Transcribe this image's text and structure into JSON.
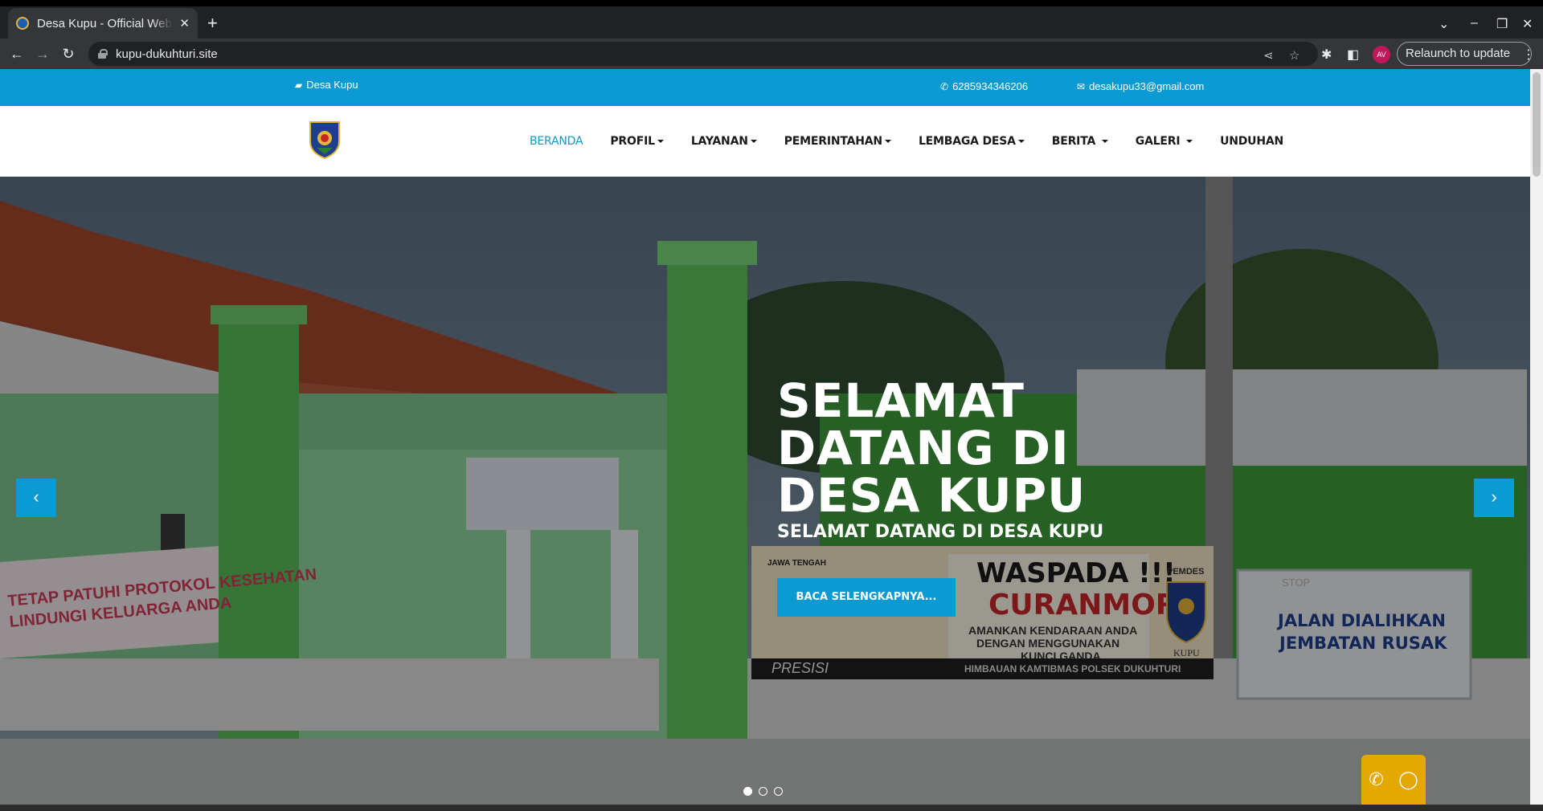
{
  "browser": {
    "tab_title": "Desa Kupu - Official Website",
    "url": "kupu-dukuhturi.site",
    "avatar_initials": "AV",
    "relaunch_label": "Relaunch to update"
  },
  "topbar": {
    "site_name": "Desa Kupu",
    "phone": "6285934346206",
    "email": "desakupu33@gmail.com"
  },
  "nav": {
    "items": [
      {
        "label": "BERANDA"
      },
      {
        "label": "PROFIL"
      },
      {
        "label": "LAYANAN"
      },
      {
        "label": "PEMERINTAHAN"
      },
      {
        "label": "LEMBAGA DESA"
      },
      {
        "label": "BERITA"
      },
      {
        "label": "GALERI"
      },
      {
        "label": "UNDUHAN"
      }
    ]
  },
  "hero": {
    "title": "SELAMAT DATANG DI DESA KUPU",
    "subtitle": "SELAMAT DATANG DI DESA KUPU",
    "button_label": "BACA SELENGKAPNYA...",
    "banner_left": "TETAP PATUHI PROTOKOL KESEHATAN LINDUNGI KELUARGA ANDA",
    "banner_waspada": "WASPADA !!!",
    "banner_curanmor": "CURANMOR",
    "banner_curanmor_sub": "AMANKAN KENDARAAN ANDA DENGAN MENGGUNAKAN KUNCI GANDA",
    "banner_bottom": "HIMBAUAN KAMTIBMAS POLSEK DUKUHTURI",
    "banner_right": "JALAN DIALIHKAN JEMBATAN RUSAK",
    "banner_jateng": "JAWA TENGAH",
    "banner_presisi": "PRESISI",
    "banner_pemdes": "PEMDES",
    "banner_kupu": "KUPU",
    "banner_stop": "STOP",
    "slides": 3,
    "active_slide": 1
  },
  "colors": {
    "accent": "#0b9ad1",
    "whatsapp_float": "#e5a800"
  }
}
